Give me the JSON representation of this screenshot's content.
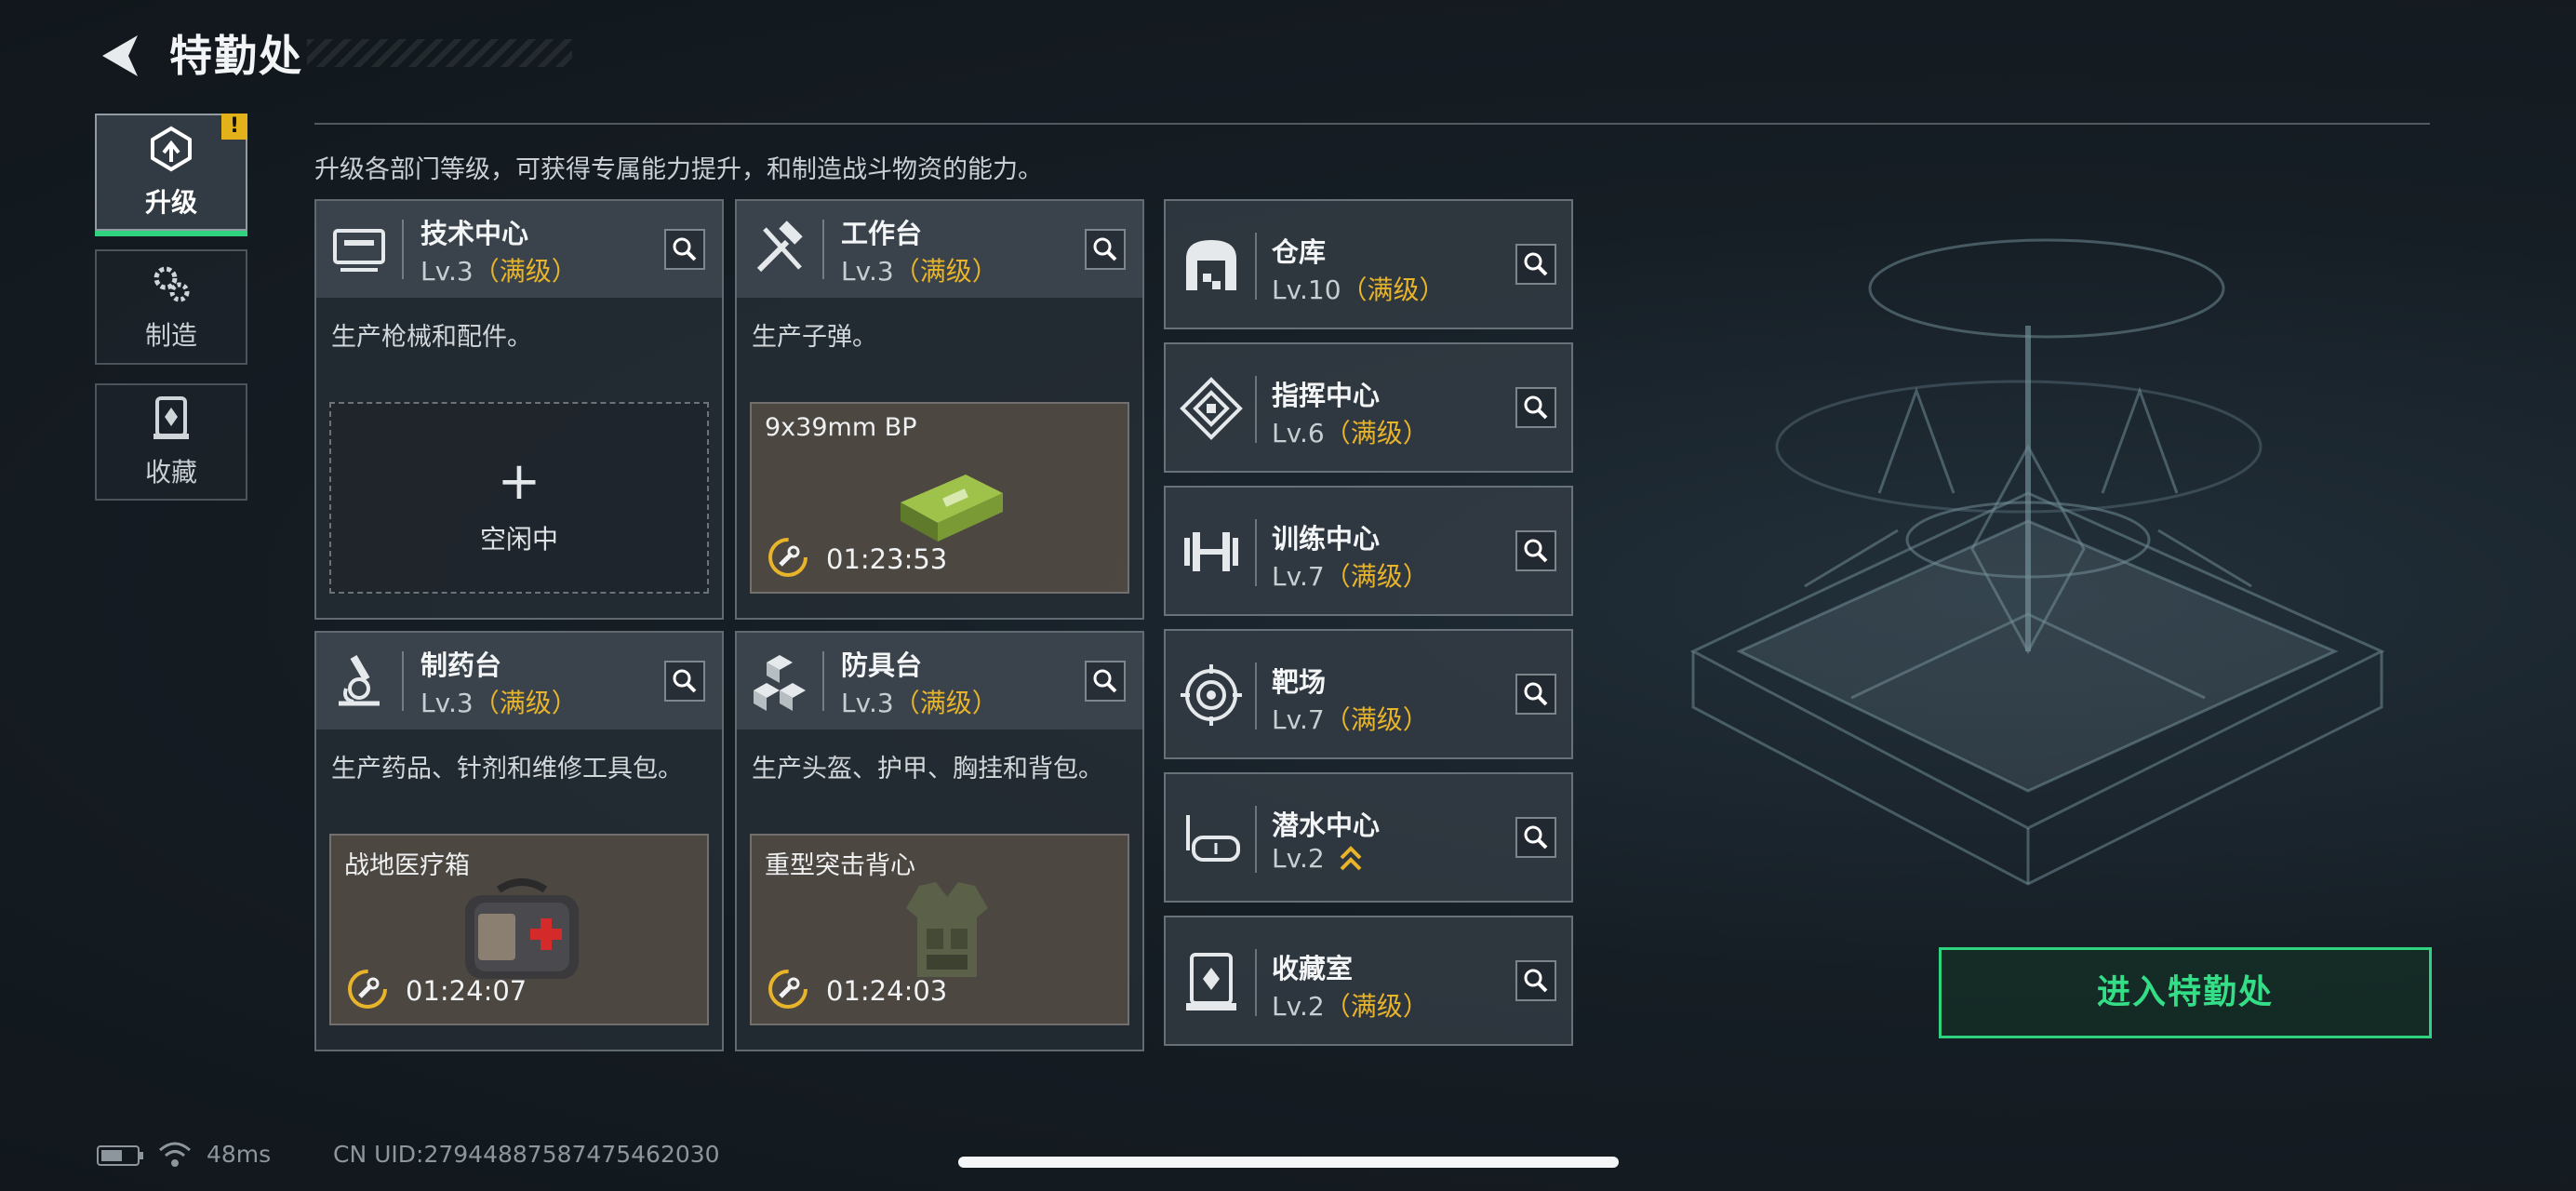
{
  "header": {
    "title": "特勤处"
  },
  "subtitle": "升级各部门等级，可获得专属能力提升，和制造战斗物资的能力。",
  "side_nav": [
    {
      "label": "升级",
      "icon": "upgrade-icon",
      "active": true,
      "badge": "!"
    },
    {
      "label": "制造",
      "icon": "gears-icon",
      "active": false
    },
    {
      "label": "收藏",
      "icon": "collection-icon",
      "active": false
    }
  ],
  "workstations": [
    {
      "name": "技术中心",
      "level": "Lv.3",
      "status": "（满级）",
      "icon": "tech-center-icon",
      "description": "生产枪械和配件。",
      "slot": {
        "state": "idle",
        "plus": "+",
        "label": "空闲中"
      }
    },
    {
      "name": "工作台",
      "level": "Lv.3",
      "status": "（满级）",
      "icon": "hammer-wrench-icon",
      "description": "生产子弹。",
      "slot": {
        "state": "crafting",
        "item": "9x39mm BP",
        "timer": "01:23:53",
        "item_icon": "ammo-box-icon"
      }
    },
    {
      "name": "制药台",
      "level": "Lv.3",
      "status": "（满级）",
      "icon": "microscope-icon",
      "description": "生产药品、针剂和维修工具包。",
      "slot": {
        "state": "crafting",
        "item": "战地医疗箱",
        "timer": "01:24:07",
        "item_icon": "medkit-icon"
      }
    },
    {
      "name": "防具台",
      "level": "Lv.3",
      "status": "（满级）",
      "icon": "armor-boxes-icon",
      "description": "生产头盔、护甲、胸挂和背包。",
      "slot": {
        "state": "crafting",
        "item": "重型突击背心",
        "timer": "01:24:03",
        "item_icon": "vest-icon"
      }
    }
  ],
  "facilities": [
    {
      "name": "仓库",
      "level": "Lv.10",
      "status": "（满级）",
      "icon": "warehouse-icon"
    },
    {
      "name": "指挥中心",
      "level": "Lv.6",
      "status": "（满级）",
      "icon": "command-center-icon"
    },
    {
      "name": "训练中心",
      "level": "Lv.7",
      "status": "（满级）",
      "icon": "dumbbell-icon"
    },
    {
      "name": "靶场",
      "level": "Lv.7",
      "status": "（满级）",
      "icon": "target-icon"
    },
    {
      "name": "潜水中心",
      "level": "Lv.2",
      "status": "",
      "icon": "diving-mask-icon",
      "upgradable": true
    },
    {
      "name": "收藏室",
      "level": "Lv.2",
      "status": "（满级）",
      "icon": "collection-room-icon"
    }
  ],
  "enter_button": "进入特勤处",
  "status_bar": {
    "ping": "48ms",
    "uid": "CN UID:27944887587475462030"
  },
  "colors": {
    "accent_green": "#2fd27f",
    "max_level_gold": "#e8b42a",
    "badge_yellow": "#e3b21a"
  }
}
